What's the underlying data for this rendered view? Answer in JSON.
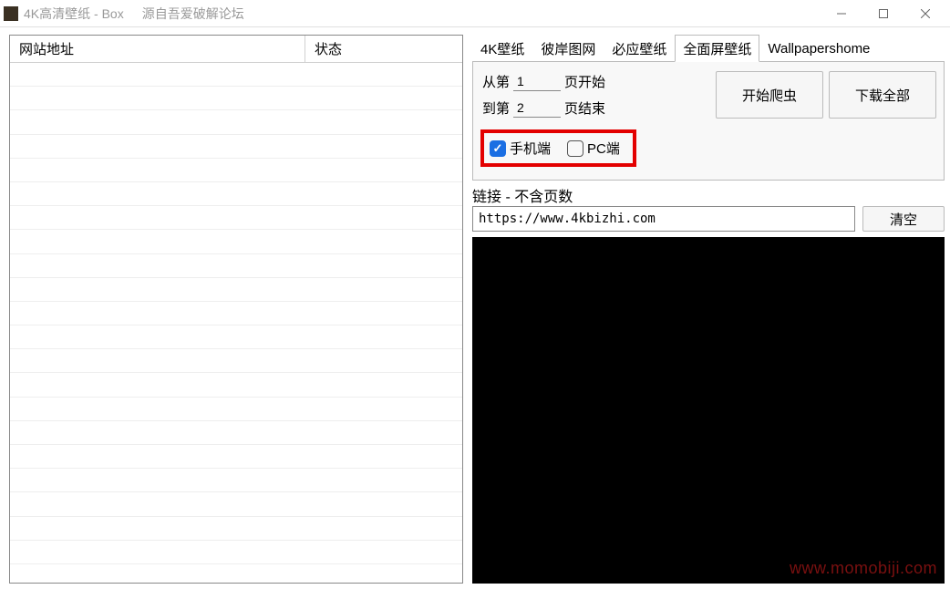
{
  "window": {
    "title": "4K高清壁纸 - Box",
    "subtitle": "源自吾爱破解论坛"
  },
  "table": {
    "headers": {
      "url": "网站地址",
      "status": "状态"
    },
    "rows": []
  },
  "tabs": [
    {
      "label": "4K壁纸",
      "active": false
    },
    {
      "label": "彼岸图网",
      "active": false
    },
    {
      "label": "必应壁纸",
      "active": false
    },
    {
      "label": "全面屏壁纸",
      "active": true
    },
    {
      "label": "Wallpapershome",
      "active": false
    }
  ],
  "pages": {
    "from_label_prefix": "从第",
    "from_value": "1",
    "from_label_suffix": "页开始",
    "to_label_prefix": "到第",
    "to_value": "2",
    "to_label_suffix": "页结束"
  },
  "buttons": {
    "start_crawl": "开始爬虫",
    "download_all": "下载全部",
    "clear": "清空"
  },
  "checkboxes": {
    "mobile": {
      "label": "手机端",
      "checked": true
    },
    "pc": {
      "label": "PC端",
      "checked": false
    }
  },
  "link_section": {
    "label": "链接 - 不含页数",
    "url": "https://www.4kbizhi.com"
  },
  "watermark": "www.momobiji.com"
}
